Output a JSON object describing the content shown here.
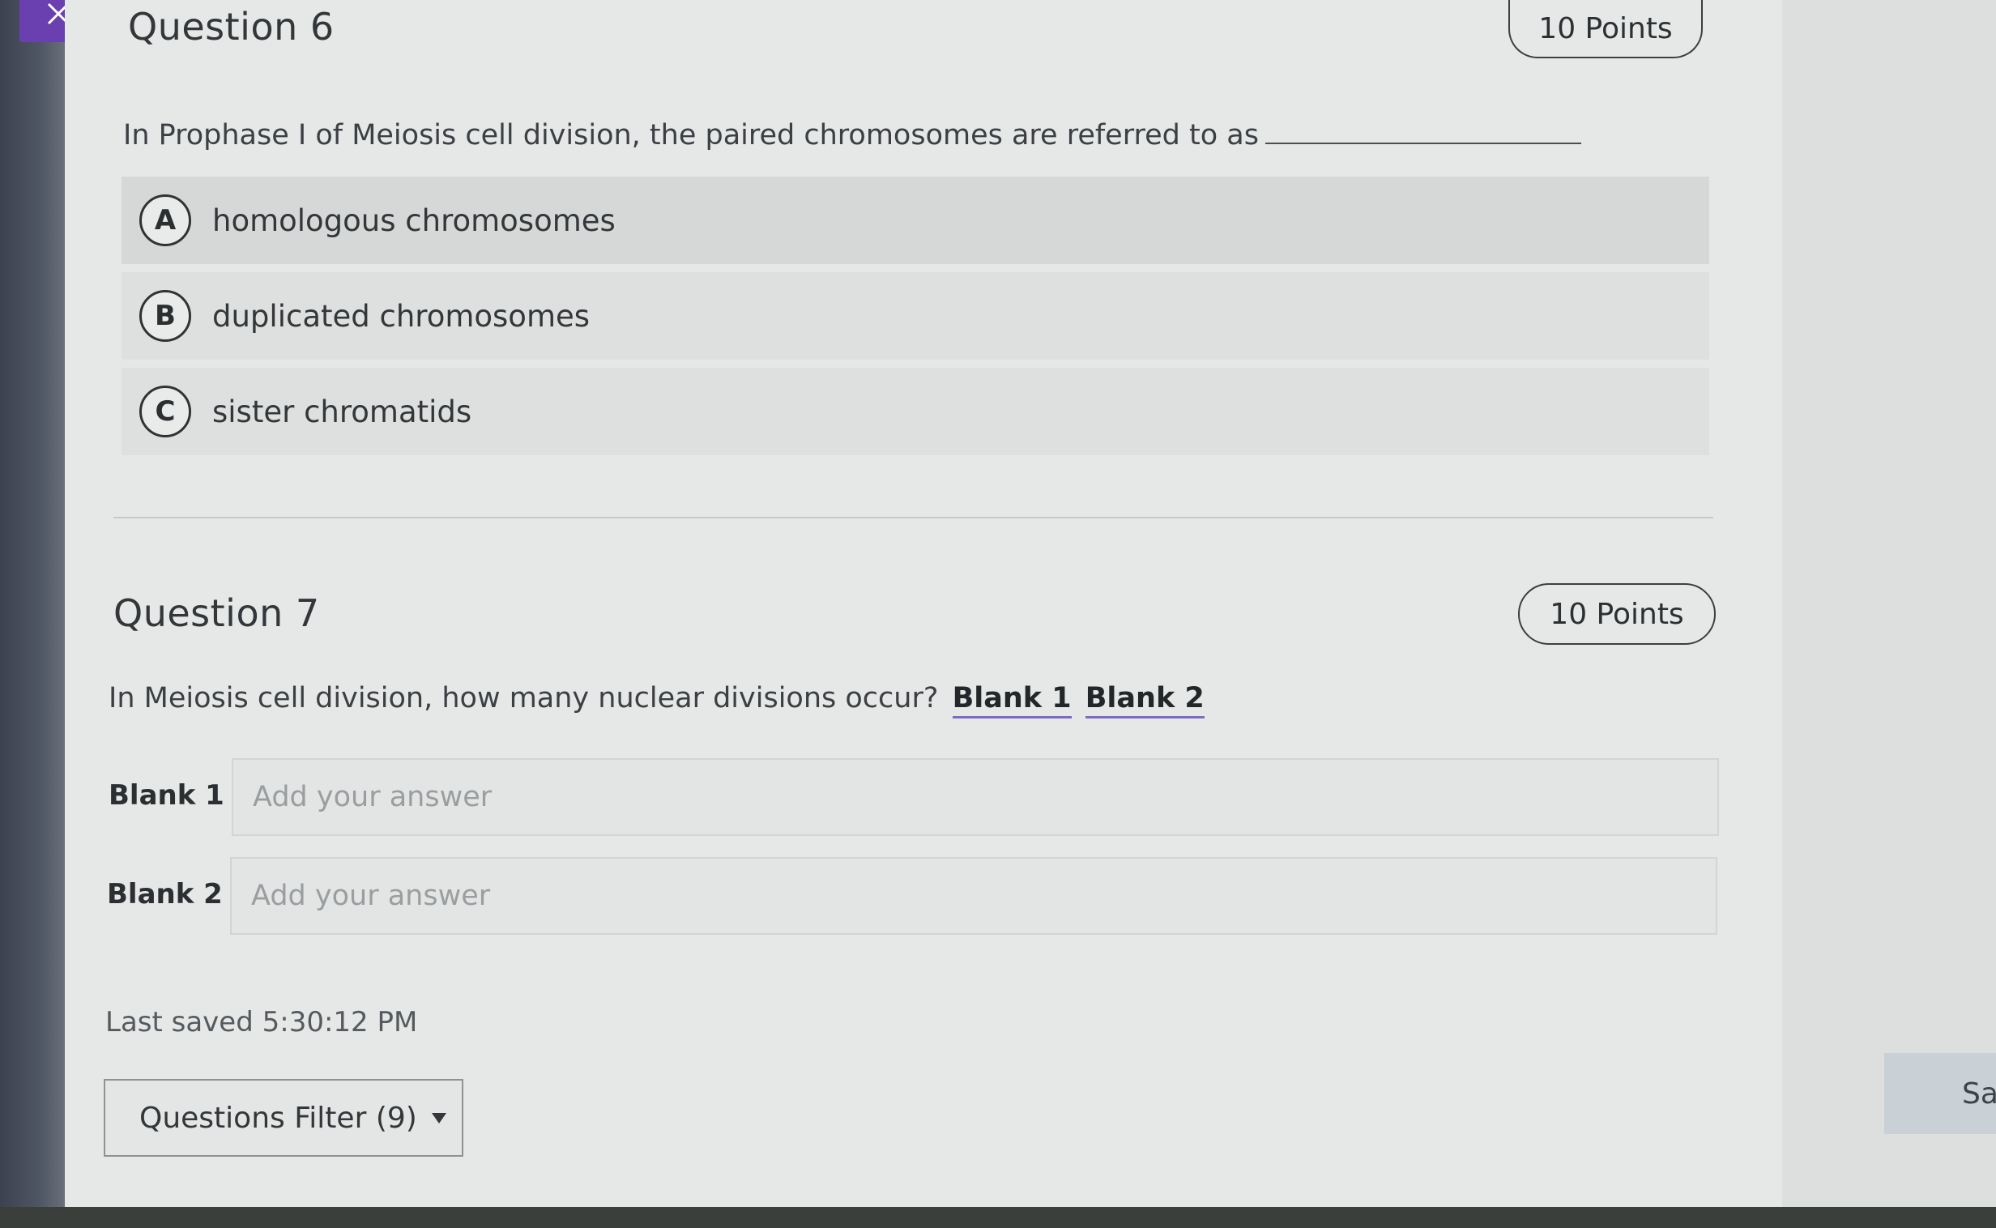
{
  "question6": {
    "title": "Question 6",
    "points": "10 Points",
    "prompt": "In Prophase I of Meiosis cell division, the paired chromosomes are referred to as",
    "options": [
      {
        "letter": "A",
        "label": "homologous chromosomes"
      },
      {
        "letter": "B",
        "label": "duplicated chromosomes"
      },
      {
        "letter": "C",
        "label": "sister chromatids"
      }
    ]
  },
  "question7": {
    "title": "Question 7",
    "points": "10 Points",
    "prompt": "In Meiosis cell division, how many nuclear divisions occur?",
    "blank_refs": [
      "Blank 1",
      "Blank 2"
    ],
    "blanks": [
      {
        "label": "Blank 1",
        "value": "",
        "placeholder": "Add your answer"
      },
      {
        "label": "Blank 2",
        "value": "",
        "placeholder": "Add your answer"
      }
    ]
  },
  "footer": {
    "last_saved": "Last saved 5:30:12 PM",
    "filter_label": "Questions Filter (9)",
    "save_label": "Sa"
  },
  "colors": {
    "accent": "#6a3fb0",
    "blank_underline": "#7b6bc4"
  }
}
